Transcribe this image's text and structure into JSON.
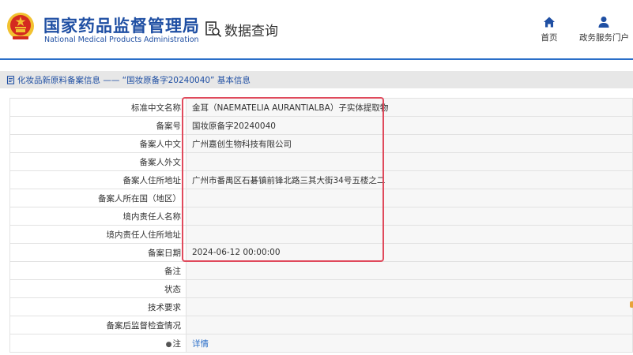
{
  "header": {
    "org_cn": "国家药品监督管理局",
    "org_en": "National Medical Products Administration",
    "section": "数据查询",
    "nav": [
      {
        "label": "首页",
        "icon": "home-icon"
      },
      {
        "label": "政务服务门户",
        "icon": "user-icon"
      }
    ]
  },
  "page": {
    "title": "化妆品新原料备案信息 —— “国妆原备字20240040” 基本信息"
  },
  "rows": [
    {
      "label": "标准中文名称",
      "value": "金耳（NAEMATELIA AURANTIALBA）子实体提取物"
    },
    {
      "label": "备案号",
      "value": "国妆原备字20240040"
    },
    {
      "label": "备案人中文",
      "value": "广州嘉创生物科技有限公司"
    },
    {
      "label": "备案人外文",
      "value": ""
    },
    {
      "label": "备案人住所地址",
      "value": "广州市番禺区石碁镇前锋北路三其大街34号五楼之二"
    },
    {
      "label": "备案人所在国（地区）",
      "value": ""
    },
    {
      "label": "境内责任人名称",
      "value": ""
    },
    {
      "label": "境内责任人住所地址",
      "value": ""
    },
    {
      "label": "备案日期",
      "value": "2024-06-12 00:00:00"
    },
    {
      "label": "备注",
      "value": ""
    },
    {
      "label": "状态",
      "value": ""
    },
    {
      "label": "技术要求",
      "value": ""
    },
    {
      "label": "备案后监督检查情况",
      "value": ""
    },
    {
      "label": "注",
      "value": "详情"
    }
  ],
  "colors": {
    "brand_blue": "#1f4fa3",
    "link_blue": "#2a6ec8",
    "highlight_red": "#e04a5c",
    "emblem_red": "#d42a20",
    "emblem_gold": "#f2c230"
  }
}
